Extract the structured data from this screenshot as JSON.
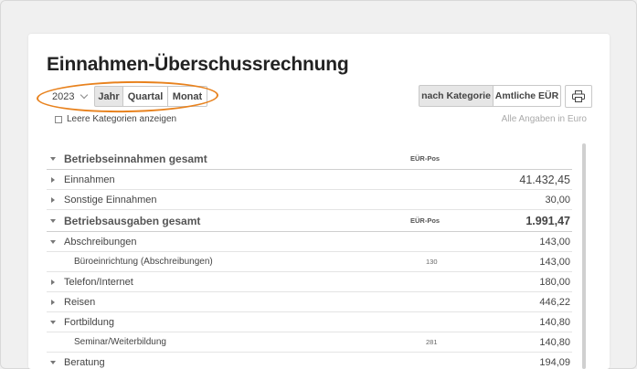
{
  "page": {
    "title": "Einnahmen-Überschussrechnung"
  },
  "period": {
    "year": "2023",
    "segments": [
      "Jahr",
      "Quartal",
      "Monat"
    ],
    "active": "Jahr"
  },
  "view": {
    "by_category": "nach Kategorie",
    "official": "Amtliche EÜR"
  },
  "options": {
    "empty_categories": "Leere Kategorien anzeigen",
    "currency_note": "Alle Angaben in Euro"
  },
  "colors": {
    "highlight": "#e8821e"
  },
  "table": {
    "rows": [
      {
        "type": "group",
        "label": "Betriebseinnahmen gesamt",
        "pos": "EÜR-Pos",
        "value": ""
      },
      {
        "type": "item",
        "expand": "right",
        "label": "Einnahmen",
        "pos": "",
        "value": "41.432,45",
        "big": true
      },
      {
        "type": "item",
        "expand": "right",
        "label": "Sonstige Einnahmen",
        "pos": "",
        "value": "30,00"
      },
      {
        "type": "group",
        "label": "Betriebsausgaben gesamt",
        "pos": "EÜR-Pos",
        "value": "1.991,47"
      },
      {
        "type": "item",
        "expand": "down",
        "label": "Abschreibungen",
        "pos": "",
        "value": "143,00"
      },
      {
        "type": "sub",
        "label": "Büroeinrichtung (Abschreibungen)",
        "pos": "130",
        "value": "143,00"
      },
      {
        "type": "item",
        "expand": "right",
        "label": "Telefon/Internet",
        "pos": "",
        "value": "180,00"
      },
      {
        "type": "item",
        "expand": "right",
        "label": "Reisen",
        "pos": "",
        "value": "446,22"
      },
      {
        "type": "item",
        "expand": "down",
        "label": "Fortbildung",
        "pos": "",
        "value": "140,80"
      },
      {
        "type": "sub",
        "label": "Seminar/Weiterbildung",
        "pos": "281",
        "value": "140,80"
      },
      {
        "type": "item",
        "expand": "down",
        "label": "Beratung",
        "pos": "",
        "value": "194,09"
      }
    ]
  }
}
